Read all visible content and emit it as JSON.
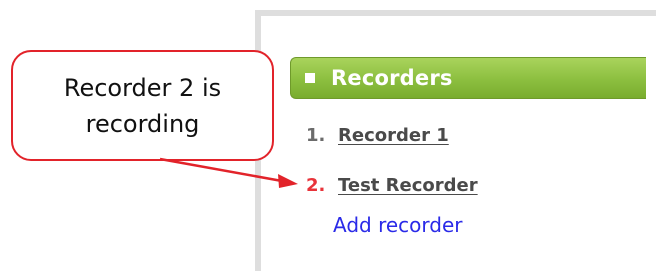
{
  "callout": {
    "text": "Recorder 2 is recording",
    "border_color": "#e2232a"
  },
  "panel": {
    "header": {
      "title": "Recorders",
      "icon": "square-bullet-icon",
      "color": "#8cbf3f"
    },
    "recorders": [
      {
        "number": "1.",
        "name": "Recorder 1",
        "recording": false
      },
      {
        "number": "2.",
        "name": "Test Recorder",
        "recording": true
      }
    ],
    "add_label": "Add recorder",
    "active_color": "#e8333a",
    "link_color": "#2a2ae8"
  }
}
